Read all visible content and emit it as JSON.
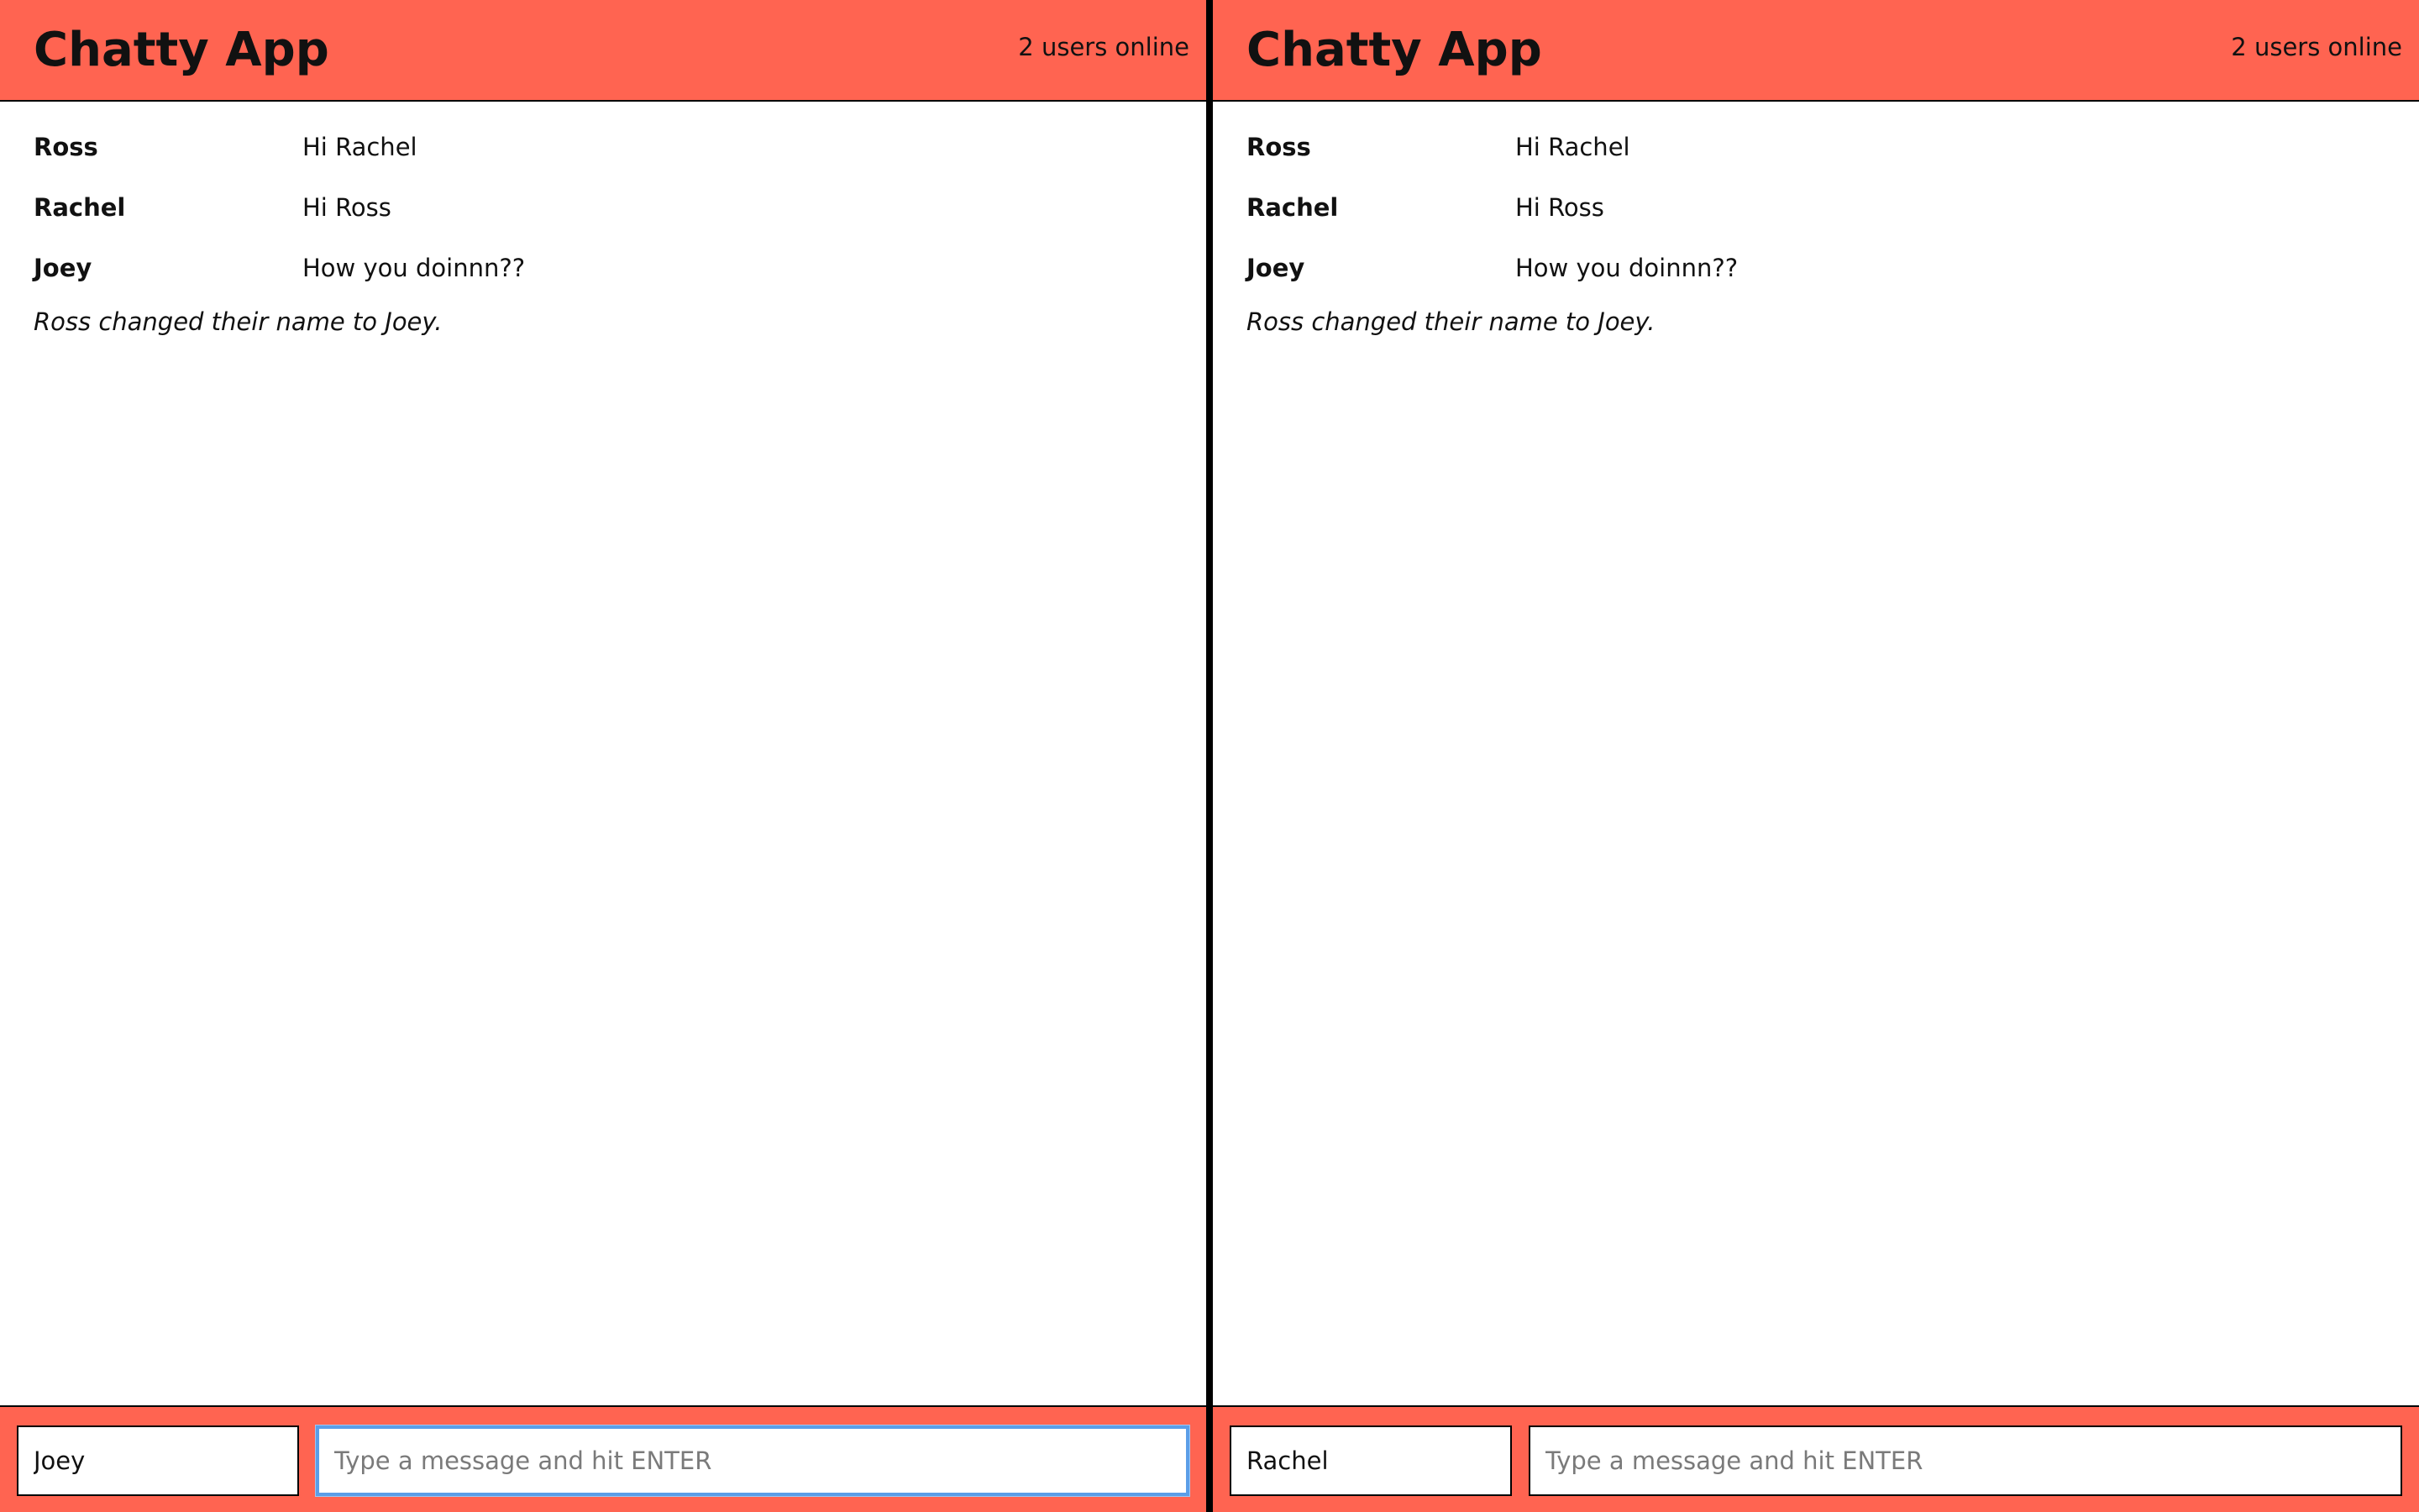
{
  "panes": [
    {
      "navbar": {
        "brand": "Chatty App",
        "users_online": "2 users online"
      },
      "messages": [
        {
          "username": "Ross",
          "content": "Hi Rachel"
        },
        {
          "username": "Rachel",
          "content": "Hi Ross"
        },
        {
          "username": "Joey",
          "content": "How you doinnn??"
        }
      ],
      "system_message": "Ross changed their name to Joey.",
      "chatbar": {
        "username_value": "Joey",
        "message_placeholder": "Type a message and hit ENTER",
        "message_value": ""
      }
    },
    {
      "navbar": {
        "brand": "Chatty App",
        "users_online": "2 users online"
      },
      "messages": [
        {
          "username": "Ross",
          "content": "Hi Rachel"
        },
        {
          "username": "Rachel",
          "content": "Hi Ross"
        },
        {
          "username": "Joey",
          "content": "How you doinnn??"
        }
      ],
      "system_message": "Ross changed their name to Joey.",
      "chatbar": {
        "username_value": "Rachel",
        "message_placeholder": "Type a message and hit ENTER",
        "message_value": ""
      }
    }
  ],
  "colors": {
    "accent": "#ff6451",
    "focus_ring": "#5b9ee8",
    "divider": "#000000"
  }
}
